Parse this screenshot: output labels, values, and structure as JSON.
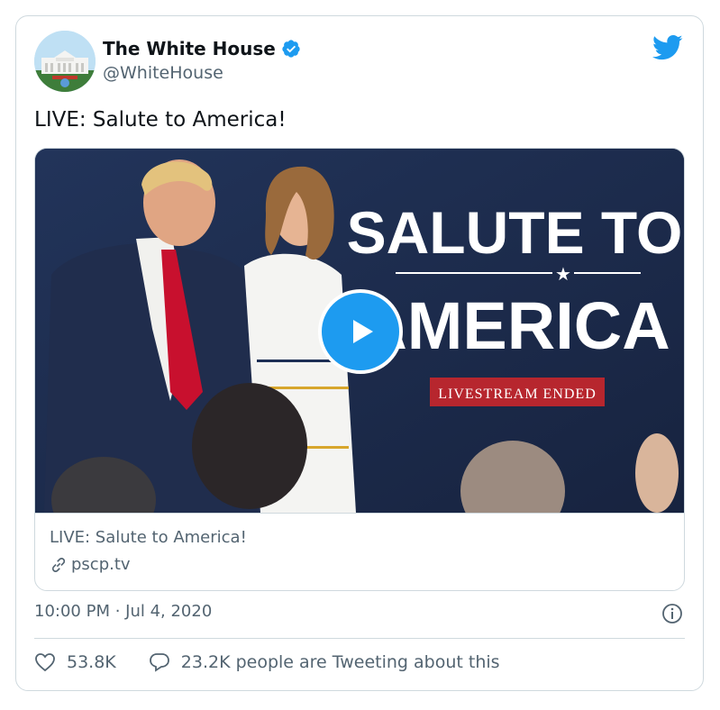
{
  "account": {
    "name": "The White House",
    "handle": "@WhiteHouse",
    "verified": true
  },
  "tweet": {
    "text": "LIVE: Salute to America!",
    "timestamp": "10:00 PM · Jul 4, 2020"
  },
  "media": {
    "headline_line1": "SALUTE TO",
    "headline_line2": "AMERICA",
    "banner": "LIVESTREAM ENDED"
  },
  "link_card": {
    "title": "LIVE: Salute to America!",
    "domain": "pscp.tv"
  },
  "engagement": {
    "likes": "53.8K",
    "conversation": "23.2K people are Tweeting about this"
  },
  "colors": {
    "brand_blue": "#1d9bf0",
    "text_secondary": "#536471",
    "banner_red": "#b7262e"
  },
  "icons": [
    "verified-badge-icon",
    "twitter-bird-icon",
    "play-icon",
    "link-icon",
    "info-icon",
    "heart-icon",
    "comment-icon"
  ]
}
